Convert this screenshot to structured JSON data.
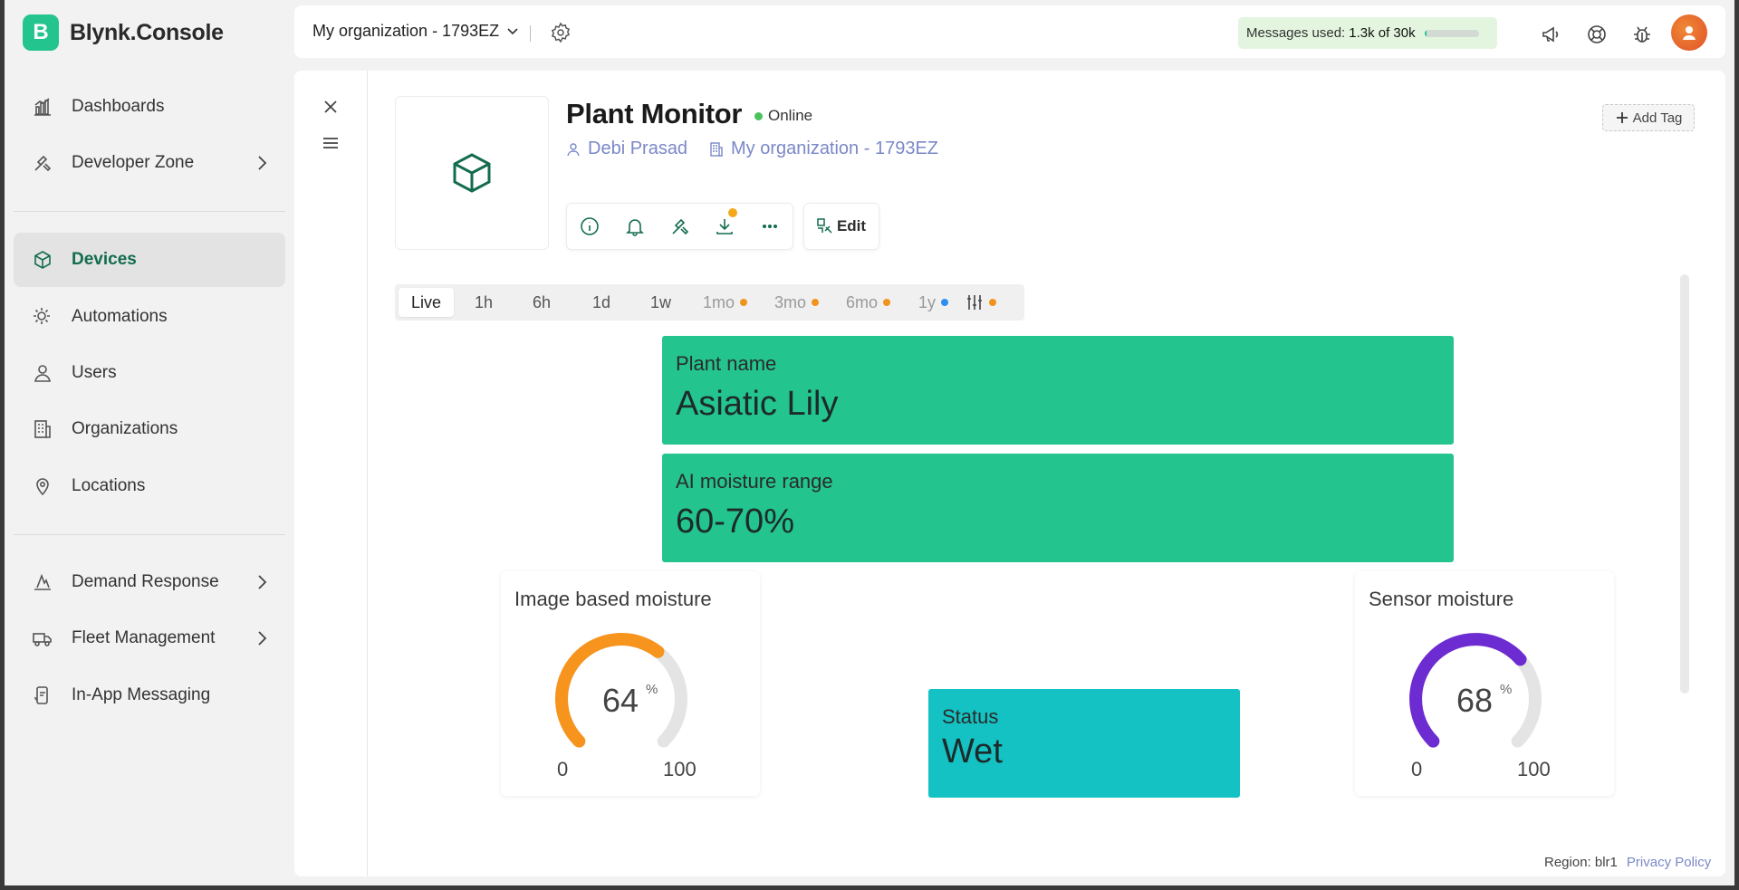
{
  "app": {
    "logo_letter": "B",
    "name": "Blynk.Console"
  },
  "sidebar": {
    "items": [
      {
        "label": "Dashboards"
      },
      {
        "label": "Developer Zone"
      },
      {
        "label": "Devices"
      },
      {
        "label": "Automations"
      },
      {
        "label": "Users"
      },
      {
        "label": "Organizations"
      },
      {
        "label": "Locations"
      },
      {
        "label": "Demand Response"
      },
      {
        "label": "Fleet Management"
      },
      {
        "label": "In-App Messaging"
      }
    ]
  },
  "header": {
    "org_name": "My organization - 1793EZ",
    "messages_prefix": "Messages used:",
    "messages_value": "1.3k of 30k",
    "messages_fraction": 0.04
  },
  "device": {
    "name": "Plant Monitor",
    "status": "Online",
    "owner": "Debi Prasad",
    "organization": "My organization - 1793EZ",
    "add_tag_label": "Add Tag",
    "edit_label": "Edit"
  },
  "time_ranges": [
    {
      "label": "Live"
    },
    {
      "label": "1h"
    },
    {
      "label": "6h"
    },
    {
      "label": "1d"
    },
    {
      "label": "1w"
    },
    {
      "label": "1mo"
    },
    {
      "label": "3mo"
    },
    {
      "label": "6mo"
    },
    {
      "label": "1y"
    }
  ],
  "widgets": {
    "plant_name": {
      "label": "Plant name",
      "value": "Asiatic Lily",
      "color": "#23c48e"
    },
    "ai_moisture": {
      "label": "AI moisture range",
      "value": "60-70%",
      "color": "#23c48e"
    },
    "image_moisture": {
      "label": "Image based moisture",
      "value": "64",
      "unit": "%",
      "min": "0",
      "max": "100",
      "fraction": 0.64,
      "color": "#f7941d"
    },
    "status": {
      "label": "Status",
      "value": "Wet",
      "color": "#14c1c3"
    },
    "sensor_moisture": {
      "label": "Sensor moisture",
      "value": "68",
      "unit": "%",
      "min": "0",
      "max": "100",
      "fraction": 0.68,
      "color": "#6d2bd2"
    }
  },
  "footer": {
    "region": "Region: blr1",
    "privacy": "Privacy Policy"
  },
  "colors": {
    "brand": "#23c48e",
    "active_nav": "#136c4f",
    "link": "#7b88c8",
    "warn_dot": "#f4a91a",
    "info_dot": "#2d8ef0"
  }
}
